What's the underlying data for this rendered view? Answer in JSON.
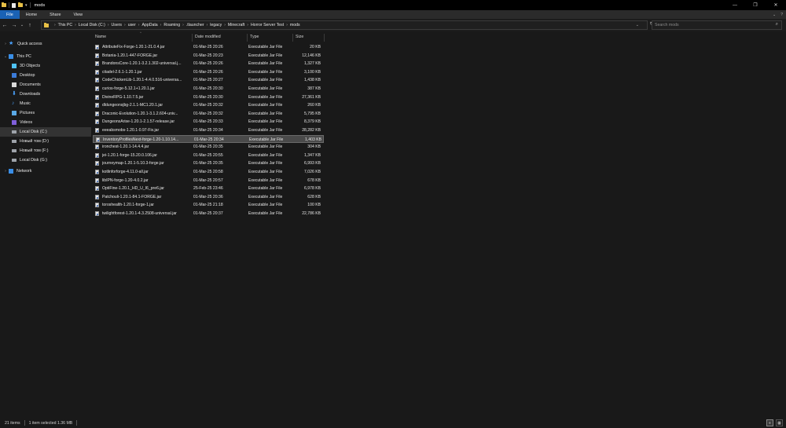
{
  "window": {
    "title": "mods",
    "minimize": "—",
    "maximize": "❐",
    "close": "✕"
  },
  "ribbon": {
    "tabs": [
      "File",
      "Home",
      "Share",
      "View"
    ],
    "help": "?"
  },
  "address": {
    "crumbs": [
      "This PC",
      "Local Disk (C:)",
      "Users",
      "user",
      "AppData",
      "Roaming",
      ".tlauncher",
      "legacy",
      "Minecraft",
      "Horror Server Test",
      "mods"
    ],
    "search_placeholder": "Search mods"
  },
  "nav": {
    "items": [
      {
        "label": "Quick access",
        "icon": "star-icon",
        "level": 0
      },
      {
        "label": "This PC",
        "icon": "pc-icon",
        "level": 0
      },
      {
        "label": "3D Objects",
        "icon": "3d-objects-icon",
        "level": 1
      },
      {
        "label": "Desktop",
        "icon": "desktop-icon",
        "level": 1
      },
      {
        "label": "Documents",
        "icon": "documents-icon",
        "level": 1
      },
      {
        "label": "Downloads",
        "icon": "downloads-icon",
        "level": 1
      },
      {
        "label": "Music",
        "icon": "music-icon",
        "level": 1
      },
      {
        "label": "Pictures",
        "icon": "pictures-icon",
        "level": 1
      },
      {
        "label": "Videos",
        "icon": "videos-icon",
        "level": 1
      },
      {
        "label": "Local Disk (C:)",
        "icon": "disk-icon",
        "level": 1
      },
      {
        "label": "Новый том (D:)",
        "icon": "disk-icon",
        "level": 1
      },
      {
        "label": "Новый том (F:)",
        "icon": "disk-icon",
        "level": 1
      },
      {
        "label": "Local Disk (G:)",
        "icon": "disk-icon",
        "level": 1
      },
      {
        "label": "Network",
        "icon": "network-icon",
        "level": 0
      }
    ]
  },
  "columns": {
    "name": "Name",
    "date": "Date modified",
    "type": "Type",
    "size": "Size"
  },
  "files": [
    {
      "name": "AttributeFix-Forge-1.20.1-21.0.4.jar",
      "date": "01-Mar-25 20:26",
      "type": "Executable Jar File",
      "size": "20 KB"
    },
    {
      "name": "Botania-1.20.1-447-FORGE.jar",
      "date": "01-Mar-25 20:23",
      "type": "Executable Jar File",
      "size": "12,146 KB"
    },
    {
      "name": "BrandonsCore-1.20.1-3.2.1.302-universal.j...",
      "date": "01-Mar-25 20:26",
      "type": "Executable Jar File",
      "size": "1,327 KB"
    },
    {
      "name": "citadel-2.6.1-1.20.1.jar",
      "date": "01-Mar-25 20:26",
      "type": "Executable Jar File",
      "size": "3,100 KB"
    },
    {
      "name": "CodeChickenLib-1.20.1-4.4.0.516-universa...",
      "date": "01-Mar-25 20:27",
      "type": "Executable Jar File",
      "size": "1,438 KB"
    },
    {
      "name": "curios-forge-5.12.1+1.20.1.jar",
      "date": "01-Mar-25 20:30",
      "type": "Executable Jar File",
      "size": "387 KB"
    },
    {
      "name": "DivineRPG-1.10.7.5.jar",
      "date": "01-Mar-25 20:30",
      "type": "Executable Jar File",
      "size": "27,361 KB"
    },
    {
      "name": "dldungeonsjbg-2.1.1-MC1.20.1.jar",
      "date": "01-Mar-25 20:32",
      "type": "Executable Jar File",
      "size": "260 KB"
    },
    {
      "name": "Draconic-Evolution-1.20.1-3.1.2.604-univ...",
      "date": "01-Mar-25 20:32",
      "type": "Executable Jar File",
      "size": "5,795 KB"
    },
    {
      "name": "DungeonsArise-1.20.1-2.1.57-release.jar",
      "date": "01-Mar-25 20:33",
      "type": "Executable Jar File",
      "size": "8,379 KB"
    },
    {
      "name": "eeeabsmobs-1.20.1-0.97-Fix.jar",
      "date": "01-Mar-25 20:34",
      "type": "Executable Jar File",
      "size": "28,282 KB"
    },
    {
      "name": "InventoryProfilesNext-forge-1.20-1.10.14...",
      "date": "01-Mar-25 20:34",
      "type": "Executable Jar File",
      "size": "1,403 KB",
      "selected": true
    },
    {
      "name": "ironchest-1.20.1-14.4.4.jar",
      "date": "01-Mar-25 20:35",
      "type": "Executable Jar File",
      "size": "304 KB"
    },
    {
      "name": "jei-1.20.1-forge-15.20.0.106.jar",
      "date": "01-Mar-25 20:55",
      "type": "Executable Jar File",
      "size": "1,347 KB"
    },
    {
      "name": "journeymap-1.20.1-5.10.3-forge.jar",
      "date": "01-Mar-25 20:35",
      "type": "Executable Jar File",
      "size": "6,993 KB"
    },
    {
      "name": "kotlinforforge-4.11.0-all.jar",
      "date": "01-Mar-25 20:58",
      "type": "Executable Jar File",
      "size": "7,026 KB"
    },
    {
      "name": "libIPN-forge-1.20-4.0.2.jar",
      "date": "01-Mar-25 20:57",
      "type": "Executable Jar File",
      "size": "678 KB"
    },
    {
      "name": "OptiFine-1.20.1_HD_U_I6_pre6.jar",
      "date": "25-Feb-25 23:46",
      "type": "Executable Jar File",
      "size": "6,978 KB"
    },
    {
      "name": "Patchouli-1.20.1-84.1-FORGE.jar",
      "date": "01-Mar-25 20:36",
      "type": "Executable Jar File",
      "size": "628 KB"
    },
    {
      "name": "toroshealth-1.20.1-forge-1.jar",
      "date": "01-Mar-25 21:18",
      "type": "Executable Jar File",
      "size": "100 KB"
    },
    {
      "name": "twilightforest-1.20.1-4.3.2508-universal.jar",
      "date": "01-Mar-25 20:37",
      "type": "Executable Jar File",
      "size": "22,786 KB"
    }
  ],
  "status": {
    "items": "21 items",
    "selected": "1 item selected  1.36 MB"
  },
  "colors": {
    "accent": "#1a62b5",
    "background": "#191919",
    "selection": "#4a4a4a"
  }
}
